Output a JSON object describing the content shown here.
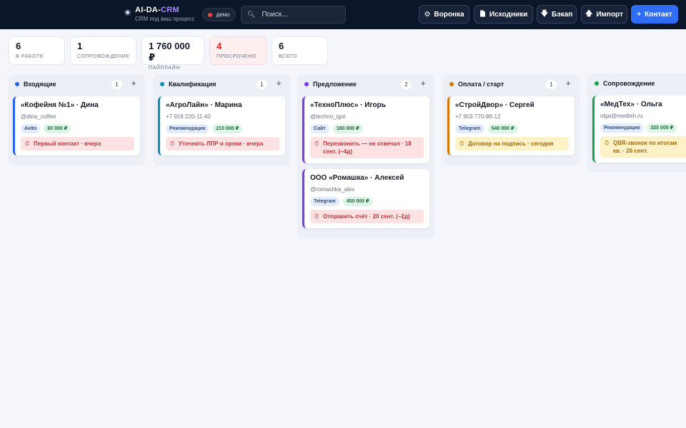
{
  "header": {
    "brand_left": "AI-DA-",
    "brand_accent": "CRM",
    "brand_sub": "CRM под ваш процесс",
    "demo_label": "демо",
    "search_placeholder": "Поиск...",
    "buttons": {
      "funnel": "Воронка",
      "sources": "Исходники",
      "backup": "Бэкап",
      "import": "Импорт",
      "contact": "Контакт"
    }
  },
  "stats": [
    {
      "value": "6",
      "label": "В РАБОТЕ"
    },
    {
      "value": "1",
      "label": "СОПРОВОЖДЕНИЕ"
    },
    {
      "value": "1 760 000 ₽",
      "label": "ПАЙПЛАЙН"
    },
    {
      "value": "4",
      "label": "ПРОСРОЧЕНО"
    },
    {
      "value": "6",
      "label": "ВСЕГО"
    }
  ],
  "columns": [
    {
      "title": "Входящие",
      "count": "1",
      "color": "#2563eb",
      "cards": [
        {
          "title": "«Кофейня №1» · Дина",
          "contact": "@dina_coffee",
          "source": "Avito",
          "amount": "60 000 ₽",
          "task": "Первый контакт · вчера",
          "task_state": "overdue"
        }
      ]
    },
    {
      "title": "Квалификация",
      "count": "1",
      "color": "#0e8fb4",
      "cards": [
        {
          "title": "«АгроЛайн» · Марина",
          "contact": "+7 916 220-11-40",
          "source": "Рекомендация",
          "amount": "210 000 ₽",
          "task": "Уточнить ЛПР и сроки · вчера",
          "task_state": "overdue"
        }
      ]
    },
    {
      "title": "Предложение",
      "count": "2",
      "color": "#7c3aed",
      "cards": [
        {
          "title": "«ТехноПлюс» · Игорь",
          "contact": "@techno_igor",
          "source": "Сайт",
          "amount": "180 000 ₽",
          "task": "Перезвонить — не отвечал · 18 сент. (−4д)",
          "task_state": "overdue"
        },
        {
          "title": "ООО «Ромашка» · Алексей",
          "contact": "@romashka_alex",
          "source": "Telegram",
          "amount": "450 000 ₽",
          "task": "Отправить счёт · 20 сент. (−2д)",
          "task_state": "overdue"
        }
      ]
    },
    {
      "title": "Оплата / старт",
      "count": "1",
      "color": "#d97706",
      "cards": [
        {
          "title": "«СтройДвор» · Сергей",
          "contact": "+7 903 770-88-12",
          "source": "Telegram",
          "amount": "540 000 ₽",
          "task": "Договор на подпись · сегодня",
          "task_state": "today"
        }
      ]
    },
    {
      "title": "Сопровождение",
      "count": "",
      "color": "#16a34a",
      "cards": [
        {
          "title": "«МедТех» · Ольга",
          "contact": "olga@medteh.ru",
          "source": "Рекомендация",
          "amount": "320 000 ₽",
          "task": "QBR-звонок по итогам кв. · 26 сент.",
          "task_state": "upcoming"
        }
      ]
    }
  ]
}
